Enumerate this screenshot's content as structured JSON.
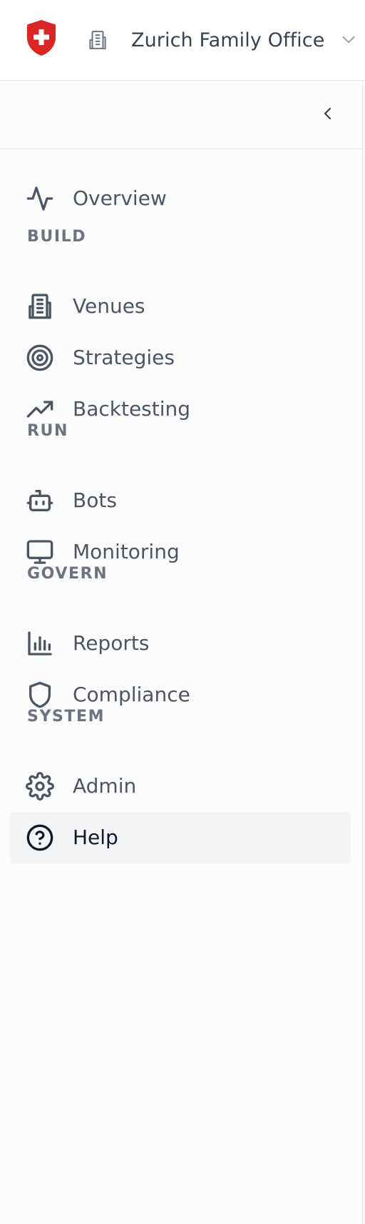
{
  "header": {
    "org_name": "Zurich Family Office",
    "logo_icon": "red-shield-swiss-cross-icon",
    "org_icon": "building-icon",
    "chevron_icon": "chevron-down-icon",
    "brand_color": "#dc2626"
  },
  "sidebar": {
    "collapse_icon": "chevron-left-icon",
    "overview": {
      "label": "Overview",
      "icon": "activity-icon"
    },
    "sections": {
      "build": "BUILD",
      "run": "RUN",
      "govern": "GOVERN",
      "system": "SYSTEM"
    },
    "items": {
      "venues": {
        "label": "Venues",
        "icon": "building-icon"
      },
      "strategies": {
        "label": "Strategies",
        "icon": "target-icon"
      },
      "backtesting": {
        "label": "Backtesting",
        "icon": "trending-up-icon"
      },
      "bots": {
        "label": "Bots",
        "icon": "bot-icon"
      },
      "monitoring": {
        "label": "Monitoring",
        "icon": "monitor-icon"
      },
      "reports": {
        "label": "Reports",
        "icon": "bar-chart-icon"
      },
      "compliance": {
        "label": "Compliance",
        "icon": "shield-icon"
      },
      "admin": {
        "label": "Admin",
        "icon": "gear-icon"
      },
      "help": {
        "label": "Help",
        "icon": "help-circle-icon",
        "active": true
      }
    },
    "active_bg": "#f3f4f6"
  }
}
